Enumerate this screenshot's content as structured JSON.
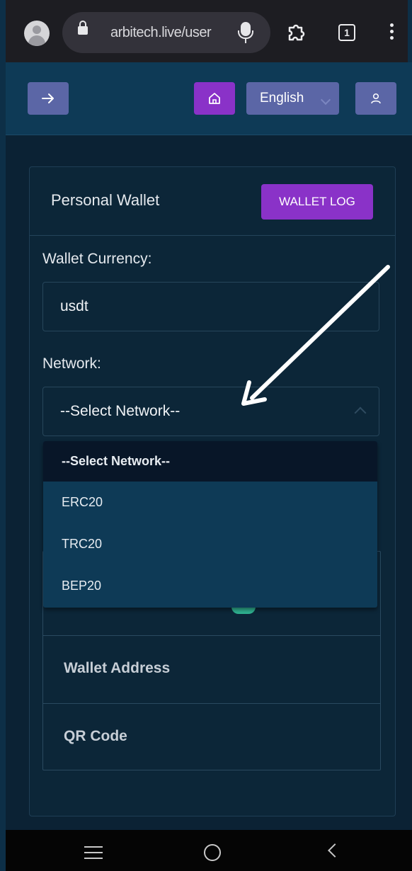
{
  "browser": {
    "url": "arbitech.live/user",
    "tab_count": "1"
  },
  "header": {
    "language": "English"
  },
  "wallet_card": {
    "title": "Personal Wallet",
    "wallet_log_label": "WALLET LOG",
    "currency_label": "Wallet Currency:",
    "currency_value": "usdt",
    "network_label": "Network:",
    "network_selected": "--Select Network--",
    "wallet_address_label": "Wallet Address",
    "qr_code_label": "QR Code"
  },
  "network_dropdown": {
    "options": [
      "--Select Network--",
      "ERC20",
      "TRC20",
      "BEP20"
    ],
    "selected_index": 0
  },
  "colors": {
    "accent_purple": "#8a32c8",
    "button_blue": "#5b66a6",
    "header_bg": "#0e3a56",
    "page_bg": "#0b2234"
  },
  "icons": {
    "profile": "account-circle-icon",
    "lock": "lock-icon",
    "mic": "microphone-icon",
    "extensions": "puzzle-icon",
    "tabs": "tab-switcher-icon",
    "menu": "kebab-menu-icon",
    "back_arrow": "arrow-right-icon",
    "home": "home-icon",
    "user": "user-icon",
    "annotation": "annotation-arrow-icon"
  }
}
